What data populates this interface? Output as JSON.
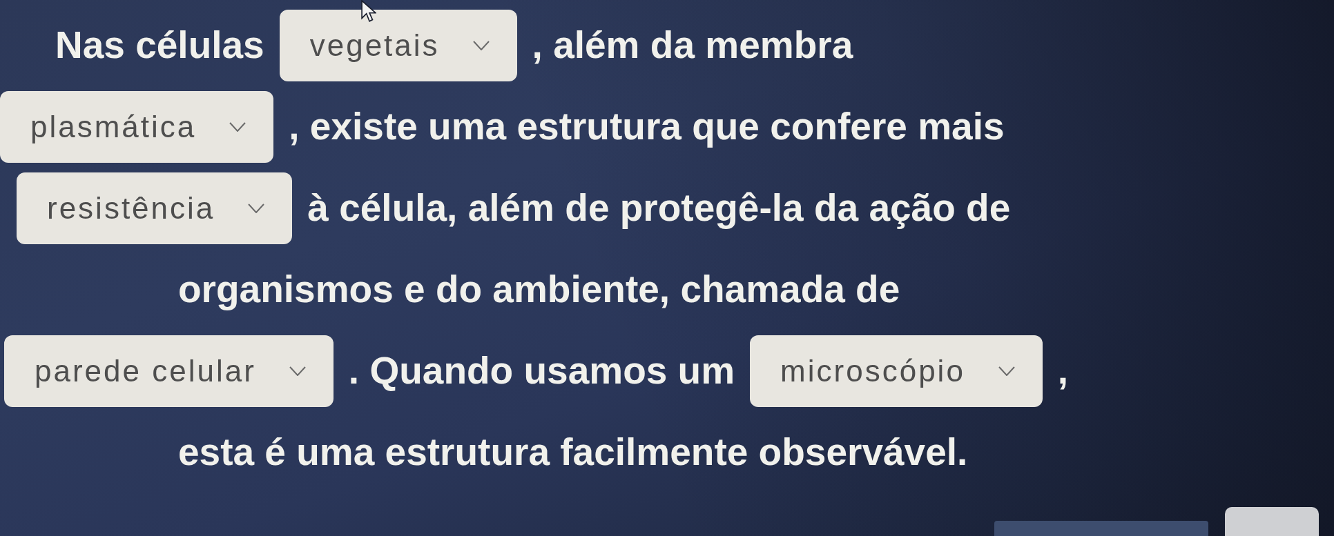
{
  "exercise": {
    "lines": [
      [
        {
          "kind": "text",
          "text": "Nas células"
        },
        {
          "kind": "dropdown",
          "value": "vegetais"
        },
        {
          "kind": "text",
          "text": ", além da membra"
        }
      ],
      [
        {
          "kind": "dropdown",
          "value": "plasmática"
        },
        {
          "kind": "text",
          "text": ", existe uma estrutura que confere mais"
        }
      ],
      [
        {
          "kind": "dropdown",
          "value": "resistência"
        },
        {
          "kind": "text",
          "text": "à célula, além de protegê-la da ação de"
        }
      ],
      [
        {
          "kind": "text",
          "text": "organismos e do ambiente, chamada de"
        }
      ],
      [
        {
          "kind": "dropdown",
          "value": "parede celular"
        },
        {
          "kind": "text",
          "text": ". Quando usamos um"
        },
        {
          "kind": "dropdown",
          "value": "microscópio"
        },
        {
          "kind": "text",
          "text": ","
        }
      ],
      [
        {
          "kind": "text",
          "text": "esta é uma estrutura facilmente observável."
        }
      ]
    ]
  }
}
